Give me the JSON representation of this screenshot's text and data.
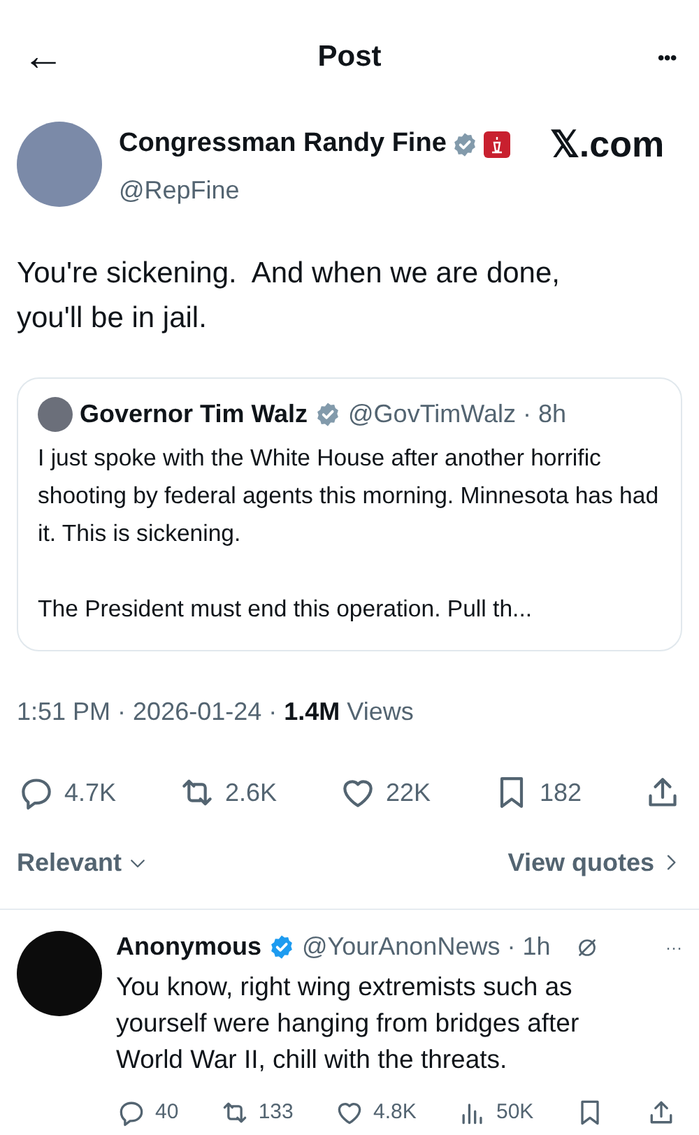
{
  "header": {
    "back": "←",
    "title": "Post",
    "more": "•••"
  },
  "post": {
    "author": {
      "name": "Congressman Randy Fine",
      "handle": "@RepFine",
      "verified": true,
      "color": "#829aab",
      "affiliate": true
    },
    "source_label": "𝕏.com",
    "text": "You're sickening.  And when we are done, you'll be in jail.",
    "quote": {
      "name": "Governor Tim Walz",
      "verified": true,
      "color": "#829aab",
      "handle": "@GovTimWalz",
      "separator": "·",
      "time": "8h",
      "paragraphs": [
        "I just spoke with the White House after another horrific shooting by federal agents this morning. Minnesota has had it. This is sickening.",
        "The President must end this operation. Pull th..."
      ]
    },
    "meta": {
      "time": "1:51 PM",
      "separator_1": "·",
      "date": "2026-01-24",
      "separator_2": "·",
      "views_count": "1.4M",
      "views_label": "Views"
    },
    "actions": [
      {
        "kind": "reply",
        "count": "4.7K"
      },
      {
        "kind": "repost",
        "count": "2.6K"
      },
      {
        "kind": "like",
        "count": "22K"
      },
      {
        "kind": "bookmark",
        "count": "182"
      },
      {
        "kind": "share"
      }
    ]
  },
  "sort": {
    "label": "Relevant",
    "quotes_link": "View quotes"
  },
  "replies": [
    {
      "name": "Anonymous",
      "verified": true,
      "color": "#1d9bf0",
      "handle": "@YourAnonNews",
      "separator": "·",
      "time": "1h",
      "more": "···",
      "text": "You know, right wing extremists such as yourself were  hanging from bridges after World War II, chill with the threats.",
      "actions": [
        {
          "kind": "reply",
          "count": "40"
        },
        {
          "kind": "repost",
          "count": "133"
        },
        {
          "kind": "like",
          "count": "4.8K"
        },
        {
          "kind": "views",
          "count": "50K"
        },
        {
          "kind": "bookmark"
        },
        {
          "kind": "share"
        }
      ]
    }
  ]
}
